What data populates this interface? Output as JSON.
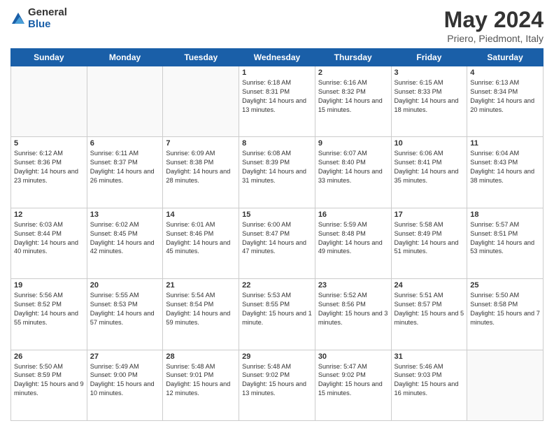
{
  "logo": {
    "general": "General",
    "blue": "Blue"
  },
  "title": "May 2024",
  "subtitle": "Priero, Piedmont, Italy",
  "days_header": [
    "Sunday",
    "Monday",
    "Tuesday",
    "Wednesday",
    "Thursday",
    "Friday",
    "Saturday"
  ],
  "weeks": [
    [
      {
        "day": "",
        "sunrise": "",
        "sunset": "",
        "daylight": ""
      },
      {
        "day": "",
        "sunrise": "",
        "sunset": "",
        "daylight": ""
      },
      {
        "day": "",
        "sunrise": "",
        "sunset": "",
        "daylight": ""
      },
      {
        "day": "1",
        "sunrise": "Sunrise: 6:18 AM",
        "sunset": "Sunset: 8:31 PM",
        "daylight": "Daylight: 14 hours and 13 minutes."
      },
      {
        "day": "2",
        "sunrise": "Sunrise: 6:16 AM",
        "sunset": "Sunset: 8:32 PM",
        "daylight": "Daylight: 14 hours and 15 minutes."
      },
      {
        "day": "3",
        "sunrise": "Sunrise: 6:15 AM",
        "sunset": "Sunset: 8:33 PM",
        "daylight": "Daylight: 14 hours and 18 minutes."
      },
      {
        "day": "4",
        "sunrise": "Sunrise: 6:13 AM",
        "sunset": "Sunset: 8:34 PM",
        "daylight": "Daylight: 14 hours and 20 minutes."
      }
    ],
    [
      {
        "day": "5",
        "sunrise": "Sunrise: 6:12 AM",
        "sunset": "Sunset: 8:36 PM",
        "daylight": "Daylight: 14 hours and 23 minutes."
      },
      {
        "day": "6",
        "sunrise": "Sunrise: 6:11 AM",
        "sunset": "Sunset: 8:37 PM",
        "daylight": "Daylight: 14 hours and 26 minutes."
      },
      {
        "day": "7",
        "sunrise": "Sunrise: 6:09 AM",
        "sunset": "Sunset: 8:38 PM",
        "daylight": "Daylight: 14 hours and 28 minutes."
      },
      {
        "day": "8",
        "sunrise": "Sunrise: 6:08 AM",
        "sunset": "Sunset: 8:39 PM",
        "daylight": "Daylight: 14 hours and 31 minutes."
      },
      {
        "day": "9",
        "sunrise": "Sunrise: 6:07 AM",
        "sunset": "Sunset: 8:40 PM",
        "daylight": "Daylight: 14 hours and 33 minutes."
      },
      {
        "day": "10",
        "sunrise": "Sunrise: 6:06 AM",
        "sunset": "Sunset: 8:41 PM",
        "daylight": "Daylight: 14 hours and 35 minutes."
      },
      {
        "day": "11",
        "sunrise": "Sunrise: 6:04 AM",
        "sunset": "Sunset: 8:43 PM",
        "daylight": "Daylight: 14 hours and 38 minutes."
      }
    ],
    [
      {
        "day": "12",
        "sunrise": "Sunrise: 6:03 AM",
        "sunset": "Sunset: 8:44 PM",
        "daylight": "Daylight: 14 hours and 40 minutes."
      },
      {
        "day": "13",
        "sunrise": "Sunrise: 6:02 AM",
        "sunset": "Sunset: 8:45 PM",
        "daylight": "Daylight: 14 hours and 42 minutes."
      },
      {
        "day": "14",
        "sunrise": "Sunrise: 6:01 AM",
        "sunset": "Sunset: 8:46 PM",
        "daylight": "Daylight: 14 hours and 45 minutes."
      },
      {
        "day": "15",
        "sunrise": "Sunrise: 6:00 AM",
        "sunset": "Sunset: 8:47 PM",
        "daylight": "Daylight: 14 hours and 47 minutes."
      },
      {
        "day": "16",
        "sunrise": "Sunrise: 5:59 AM",
        "sunset": "Sunset: 8:48 PM",
        "daylight": "Daylight: 14 hours and 49 minutes."
      },
      {
        "day": "17",
        "sunrise": "Sunrise: 5:58 AM",
        "sunset": "Sunset: 8:49 PM",
        "daylight": "Daylight: 14 hours and 51 minutes."
      },
      {
        "day": "18",
        "sunrise": "Sunrise: 5:57 AM",
        "sunset": "Sunset: 8:51 PM",
        "daylight": "Daylight: 14 hours and 53 minutes."
      }
    ],
    [
      {
        "day": "19",
        "sunrise": "Sunrise: 5:56 AM",
        "sunset": "Sunset: 8:52 PM",
        "daylight": "Daylight: 14 hours and 55 minutes."
      },
      {
        "day": "20",
        "sunrise": "Sunrise: 5:55 AM",
        "sunset": "Sunset: 8:53 PM",
        "daylight": "Daylight: 14 hours and 57 minutes."
      },
      {
        "day": "21",
        "sunrise": "Sunrise: 5:54 AM",
        "sunset": "Sunset: 8:54 PM",
        "daylight": "Daylight: 14 hours and 59 minutes."
      },
      {
        "day": "22",
        "sunrise": "Sunrise: 5:53 AM",
        "sunset": "Sunset: 8:55 PM",
        "daylight": "Daylight: 15 hours and 1 minute."
      },
      {
        "day": "23",
        "sunrise": "Sunrise: 5:52 AM",
        "sunset": "Sunset: 8:56 PM",
        "daylight": "Daylight: 15 hours and 3 minutes."
      },
      {
        "day": "24",
        "sunrise": "Sunrise: 5:51 AM",
        "sunset": "Sunset: 8:57 PM",
        "daylight": "Daylight: 15 hours and 5 minutes."
      },
      {
        "day": "25",
        "sunrise": "Sunrise: 5:50 AM",
        "sunset": "Sunset: 8:58 PM",
        "daylight": "Daylight: 15 hours and 7 minutes."
      }
    ],
    [
      {
        "day": "26",
        "sunrise": "Sunrise: 5:50 AM",
        "sunset": "Sunset: 8:59 PM",
        "daylight": "Daylight: 15 hours and 9 minutes."
      },
      {
        "day": "27",
        "sunrise": "Sunrise: 5:49 AM",
        "sunset": "Sunset: 9:00 PM",
        "daylight": "Daylight: 15 hours and 10 minutes."
      },
      {
        "day": "28",
        "sunrise": "Sunrise: 5:48 AM",
        "sunset": "Sunset: 9:01 PM",
        "daylight": "Daylight: 15 hours and 12 minutes."
      },
      {
        "day": "29",
        "sunrise": "Sunrise: 5:48 AM",
        "sunset": "Sunset: 9:02 PM",
        "daylight": "Daylight: 15 hours and 13 minutes."
      },
      {
        "day": "30",
        "sunrise": "Sunrise: 5:47 AM",
        "sunset": "Sunset: 9:02 PM",
        "daylight": "Daylight: 15 hours and 15 minutes."
      },
      {
        "day": "31",
        "sunrise": "Sunrise: 5:46 AM",
        "sunset": "Sunset: 9:03 PM",
        "daylight": "Daylight: 15 hours and 16 minutes."
      },
      {
        "day": "",
        "sunrise": "",
        "sunset": "",
        "daylight": ""
      }
    ]
  ]
}
